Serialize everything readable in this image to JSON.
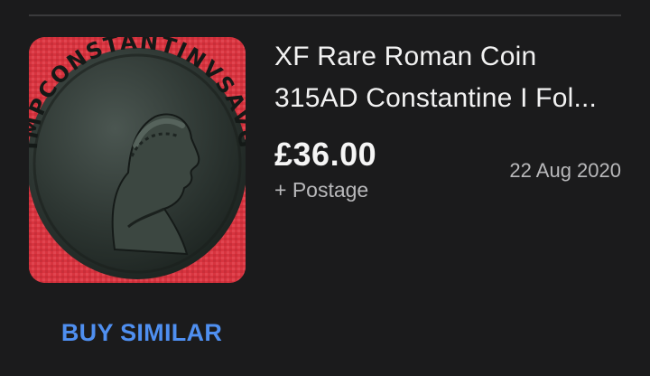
{
  "listing": {
    "title_line1": "XF Rare Roman Coin",
    "title_line2": "315AD Constantine I Fol...",
    "price": "£36.00",
    "postage": "+ Postage",
    "date": "22 Aug 2020",
    "image_legend": "IMPCONSTANTINVSAVG",
    "image_bg_color": "#d8343f",
    "coin_color": "#2d3532"
  },
  "actions": {
    "buy_similar_label": "BUY SIMILAR",
    "accent_color": "#4f8ff0"
  }
}
